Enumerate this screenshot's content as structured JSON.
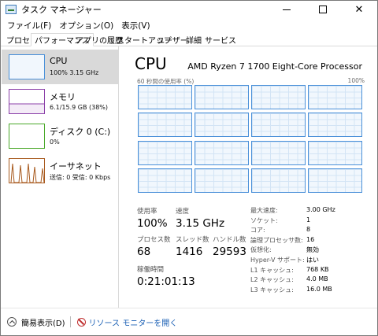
{
  "window": {
    "title": "タスク マネージャー"
  },
  "menu": [
    "ファイル(F)",
    "オプション(O)",
    "表示(V)"
  ],
  "tabs": [
    "プロセス",
    "パフォーマンス",
    "アプリの履歴",
    "スタートアップ",
    "ユーザー",
    "詳細",
    "サービス"
  ],
  "active_tab": "パフォーマンス",
  "sidebar": {
    "items": [
      {
        "name": "CPU",
        "detail": "100% 3.15 GHz",
        "selected": true
      },
      {
        "name": "メモリ",
        "detail": "6.1/15.9 GB (38%)"
      },
      {
        "name": "ディスク 0 (C:)",
        "detail": "0%"
      },
      {
        "name": "イーサネット",
        "detail": "送信: 0 受信: 0 Kbps"
      }
    ]
  },
  "cpu": {
    "title": "CPU",
    "model": "AMD Ryzen 7 1700 Eight-Core Processor",
    "graph_label": "60 秒間の使用率 (%)",
    "graph_max": "100%",
    "core_count": 16,
    "stats": {
      "usage_label": "使用率",
      "usage": "100%",
      "speed_label": "速度",
      "speed": "3.15 GHz",
      "processes_label": "プロセス数",
      "processes": "68",
      "threads_label": "スレッド数",
      "threads": "1416",
      "handles_label": "ハンドル数",
      "handles": "29593",
      "uptime_label": "稼働時間",
      "uptime": "0:21:01:13"
    },
    "specs": [
      {
        "key": "最大速度:",
        "value": "3.00 GHz"
      },
      {
        "key": "ソケット:",
        "value": "1"
      },
      {
        "key": "コア:",
        "value": "8"
      },
      {
        "key": "論理プロセッサ数:",
        "value": "16"
      },
      {
        "key": "仮想化:",
        "value": "無効"
      },
      {
        "key": "Hyper-V サポート:",
        "value": "はい"
      },
      {
        "key": "L1 キャッシュ:",
        "value": "768 KB"
      },
      {
        "key": "L2 キャッシュ:",
        "value": "4.0 MB"
      },
      {
        "key": "L3 キャッシュ:",
        "value": "16.0 MB"
      }
    ]
  },
  "footer": {
    "fewer_details": "簡易表示(D)",
    "resource_monitor": "リソース モニターを開く"
  },
  "colors": {
    "cpu": "#4a90d9",
    "memory": "#8b3fa8",
    "disk": "#4aa829",
    "network": "#a85a1e"
  }
}
